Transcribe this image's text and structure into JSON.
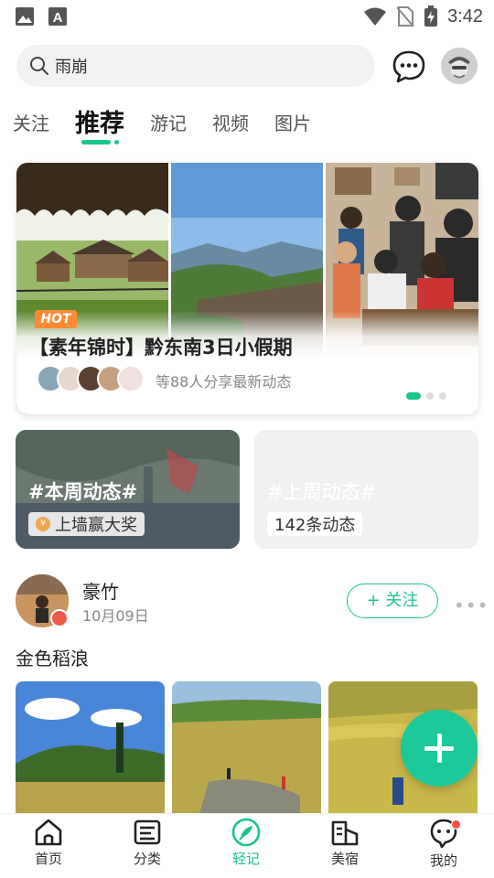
{
  "status_bar": {
    "time": "3:42"
  },
  "search": {
    "value": "雨崩"
  },
  "tabs": [
    {
      "label": "关注",
      "active": false
    },
    {
      "label": "推荐",
      "active": true
    },
    {
      "label": "游记",
      "active": false
    },
    {
      "label": "视频",
      "active": false
    },
    {
      "label": "图片",
      "active": false
    }
  ],
  "banner": {
    "badge": "HOT",
    "title": "【素年锦时】黔东南3日小假期",
    "subtitle": "等88人分享最新动态",
    "page_count": 3,
    "active_page": 0
  },
  "weekly": {
    "this_week": {
      "title": "#本周动态#",
      "pill": "上墙赢大奖"
    },
    "last_week": {
      "title": "#上周动态#",
      "pill": "142条动态"
    }
  },
  "post": {
    "username": "豪竹",
    "date": "10月09日",
    "follow_label": "+ 关注",
    "more_label": "•••",
    "text": "金色稻浪"
  },
  "bottom_nav": [
    {
      "label": "首页",
      "icon": "home-icon",
      "active": false
    },
    {
      "label": "分类",
      "icon": "category-icon",
      "active": false
    },
    {
      "label": "轻记",
      "icon": "feather-icon",
      "active": true
    },
    {
      "label": "美宿",
      "icon": "hotel-icon",
      "active": false
    },
    {
      "label": "我的",
      "icon": "profile-icon",
      "active": false
    }
  ],
  "colors": {
    "accent": "#1bc48f",
    "hot": "#ff8a34",
    "notification": "#ff4a4a"
  }
}
